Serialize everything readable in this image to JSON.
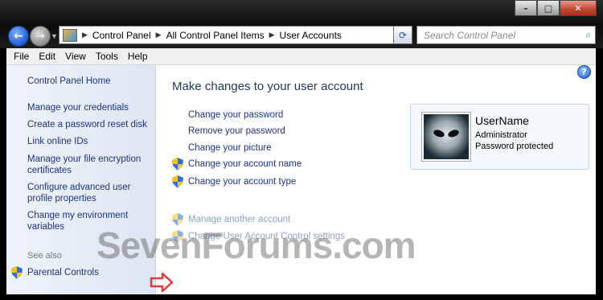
{
  "window": {
    "caption_buttons": [
      "minimize",
      "maximize",
      "close"
    ]
  },
  "address": {
    "crumbs": [
      "Control Panel",
      "All Control Panel Items",
      "User Accounts"
    ]
  },
  "search": {
    "placeholder": "Search Control Panel"
  },
  "menu": [
    "File",
    "Edit",
    "View",
    "Tools",
    "Help"
  ],
  "sidebar": {
    "home": "Control Panel Home",
    "items": [
      "Manage your credentials",
      "Create a password reset disk",
      "Link online IDs",
      "Manage your file encryption certificates",
      "Configure advanced user profile properties",
      "Change my environment variables"
    ],
    "see_also": "See also",
    "parental": "Parental Controls"
  },
  "main": {
    "heading": "Make changes to your user account",
    "tasks": [
      "Change your password",
      "Remove your password",
      "Change your picture",
      "Change your account name",
      "Change your account type",
      "Manage another account",
      "Change User Account Control settings"
    ]
  },
  "user": {
    "name": "UserName",
    "role": "Administrator",
    "status": "Password protected"
  },
  "watermark": "SevenForums.com",
  "colors": {
    "link": "#1e3287",
    "heading": "#1e395b",
    "arrow": "#e23b3b"
  }
}
